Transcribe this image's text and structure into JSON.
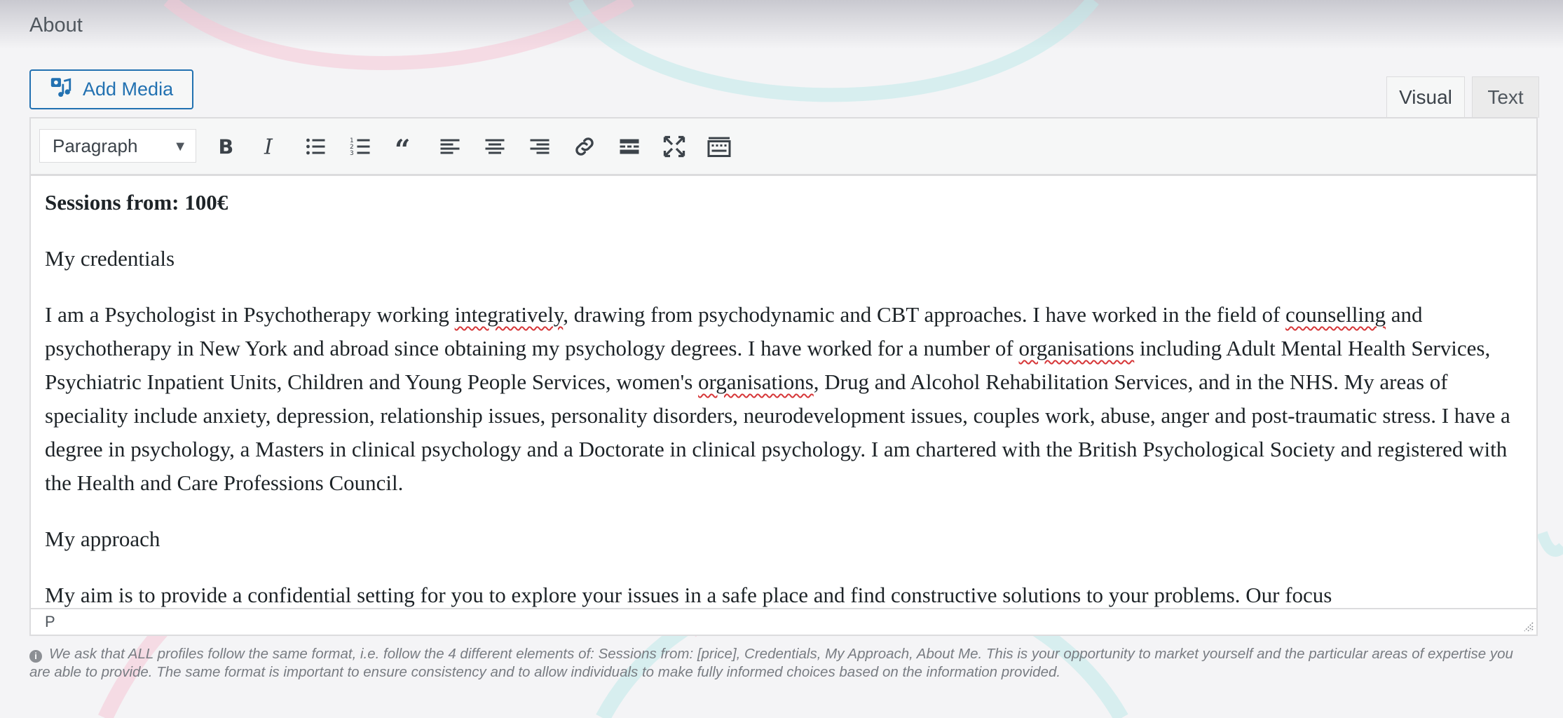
{
  "section": {
    "label": "About"
  },
  "media": {
    "add_label": "Add Media"
  },
  "tabs": {
    "visual": "Visual",
    "text": "Text"
  },
  "toolbar": {
    "format_select": "Paragraph",
    "buttons": [
      "bold-icon",
      "italic-icon",
      "bulleted-list-icon",
      "numbered-list-icon",
      "blockquote-icon",
      "align-left-icon",
      "align-center-icon",
      "align-right-icon",
      "link-icon",
      "read-more-icon",
      "fullscreen-icon",
      "toolbar-toggle-icon"
    ]
  },
  "content": {
    "p1": "Sessions from: 100€",
    "p2": "My credentials",
    "p3": {
      "t1": "I am a Psychologist in Psychotherapy working ",
      "w1": "integratively",
      "t2": ", drawing from psychodynamic and CBT approaches. I have worked in the field of ",
      "w2": "counselling",
      "t3": " and psychotherapy in New York and abroad since obtaining my psychology degrees. I have worked for a number of ",
      "w3": "organisations",
      "t4": " including Adult Mental Health Services, Psychiatric Inpatient Units, Children and Young People Services, women's ",
      "w4": "organisations",
      "t5": ", Drug and Alcohol Rehabilitation Services, and in the NHS. My areas of speciality include anxiety, depression, relationship issues, personality disorders, neurodevelopment issues, couples work, abuse, anger and post-traumatic stress. I have a degree in psychology, a Masters in clinical psychology and a Doctorate in clinical psychology. I am chartered with the British Psychological Society and registered with the Health and Care Professions Council."
    },
    "p4": "My approach",
    "p5": "My aim is to provide a confidential setting for you to explore your issues in a safe place and find constructive solutions to your problems. Our focus"
  },
  "statusbar": {
    "path": "P"
  },
  "help": {
    "text": "We ask that ALL profiles follow the same format, i.e. follow the 4 different elements of: Sessions from: [price], Credentials, My Approach, About Me. This is your opportunity to market yourself and the particular areas of expertise you are able to provide. The same format is important to ensure consistency and to allow individuals to make fully informed choices based on the information provided."
  },
  "colors": {
    "accent": "#2271b1",
    "misspell": "#d63638",
    "deco_pink": "#f6c7d6",
    "deco_teal": "#bfe9e9"
  }
}
